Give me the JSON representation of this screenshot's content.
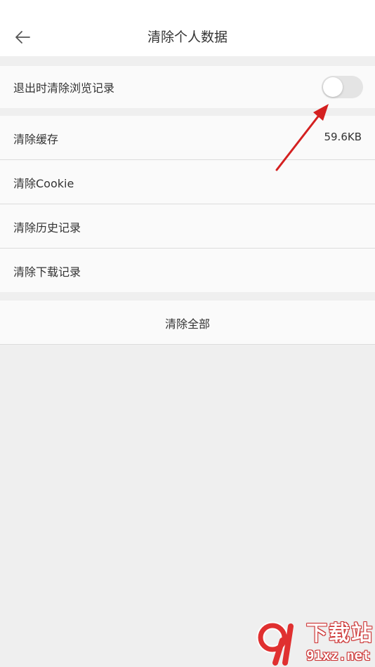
{
  "header": {
    "title": "清除个人数据",
    "back_icon": "arrow-left-icon"
  },
  "settings": {
    "clear_on_exit": {
      "label": "退出时清除浏览记录",
      "enabled": false
    },
    "clear_cache": {
      "label": "清除缓存",
      "value": "59.6KB"
    },
    "clear_cookie": {
      "label": "清除Cookie"
    },
    "clear_history": {
      "label": "清除历史记录"
    },
    "clear_downloads": {
      "label": "清除下载记录"
    },
    "clear_all": {
      "label": "清除全部"
    }
  },
  "watermark": {
    "title": "下载站",
    "domain": "91xz.net"
  },
  "colors": {
    "page_background": "#efefef",
    "row_background": "#fafafa",
    "toggle_off": "#e4e4e4",
    "annotation_arrow": "#d42020",
    "watermark_red": "#e03030"
  }
}
